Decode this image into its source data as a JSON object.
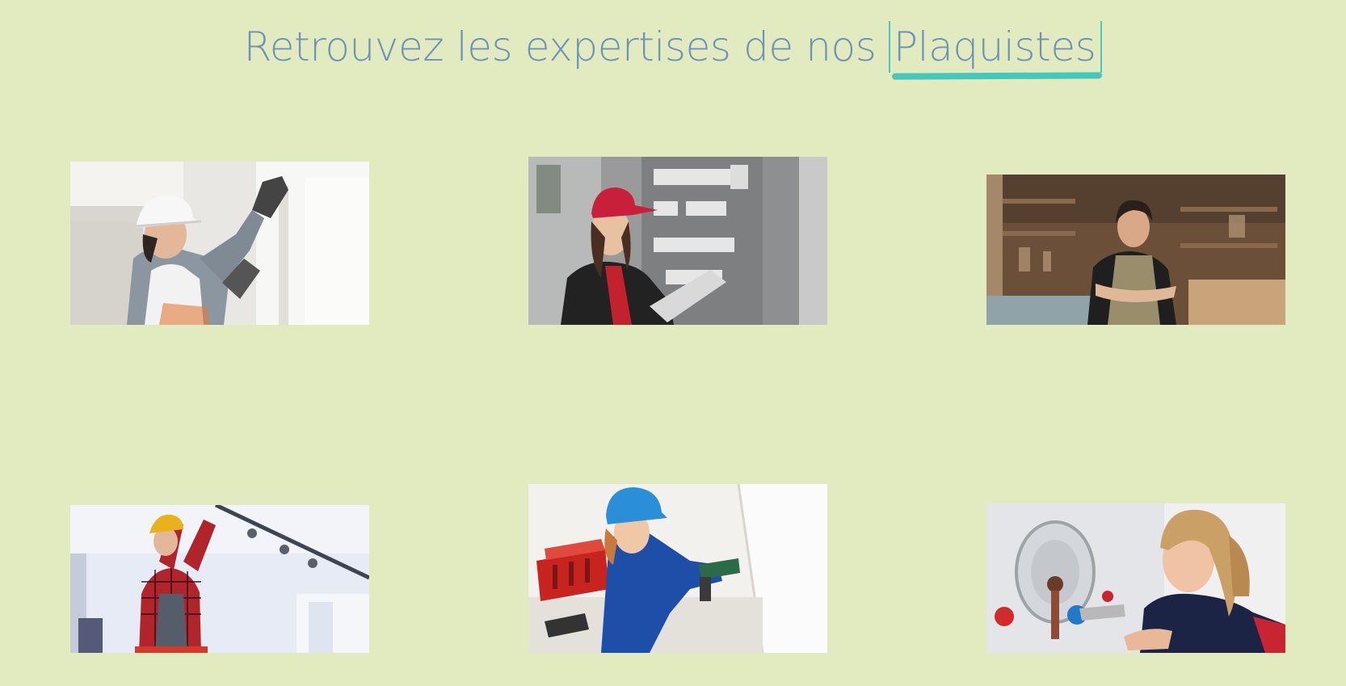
{
  "header": {
    "title_prefix": "Retrouvez les expertises de nos",
    "title_highlight": "Plaquistes"
  },
  "colors": {
    "background": "#e2ebc0",
    "title": "#6f93b7",
    "accent": "#44c7bc"
  },
  "gallery": [
    {
      "subject": "worker-helmet-drywall"
    },
    {
      "subject": "electrician-red-cap-panel"
    },
    {
      "subject": "woodworker-workshop"
    },
    {
      "subject": "electrician-plaid-ceiling"
    },
    {
      "subject": "worker-blue-helmet-drill"
    },
    {
      "subject": "plumber-water-heater"
    }
  ]
}
